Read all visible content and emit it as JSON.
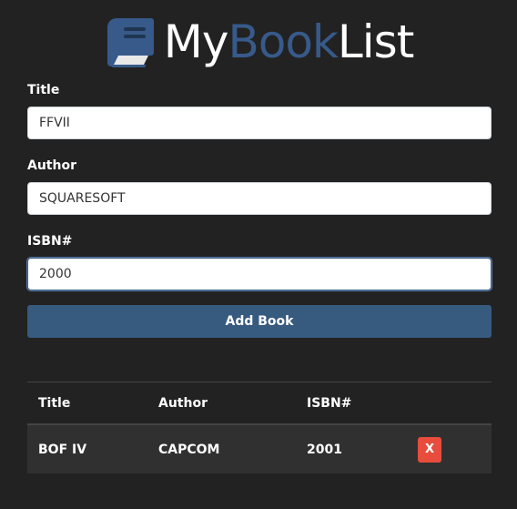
{
  "brand": {
    "title_part1": "My",
    "title_part2": "Book",
    "title_part3": "List",
    "accent_color": "#375a8a",
    "icon": "book-icon"
  },
  "form": {
    "title_label": "Title",
    "title_value": "FFVII",
    "author_label": "Author",
    "author_value": "SQUARESOFT",
    "isbn_label": "ISBN#",
    "isbn_value": "2000",
    "submit_label": "Add Book"
  },
  "table": {
    "headers": [
      "Title",
      "Author",
      "ISBN#"
    ],
    "rows": [
      {
        "title": "BOF IV",
        "author": "CAPCOM",
        "isbn": "2001",
        "delete_label": "X"
      }
    ]
  },
  "colors": {
    "background": "#222222",
    "primary": "#375a7f",
    "danger": "#e74c3c"
  }
}
